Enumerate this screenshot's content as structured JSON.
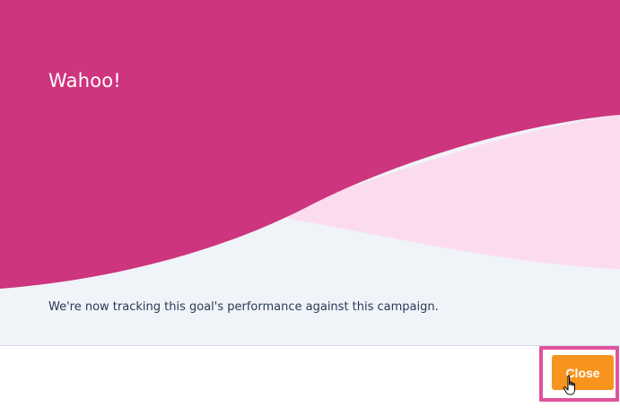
{
  "dialog": {
    "title": "Wahoo!",
    "message": "We're now tracking this goal's performance against this campaign.",
    "close_label": "Close"
  },
  "colors": {
    "magenta": "#cd357e",
    "light_pink": "#fbdcef",
    "background": "#f0f3f8",
    "button": "#f7941d",
    "highlight_border": "#e0529c"
  },
  "icons": {
    "cursor": "hand-pointer-icon"
  }
}
